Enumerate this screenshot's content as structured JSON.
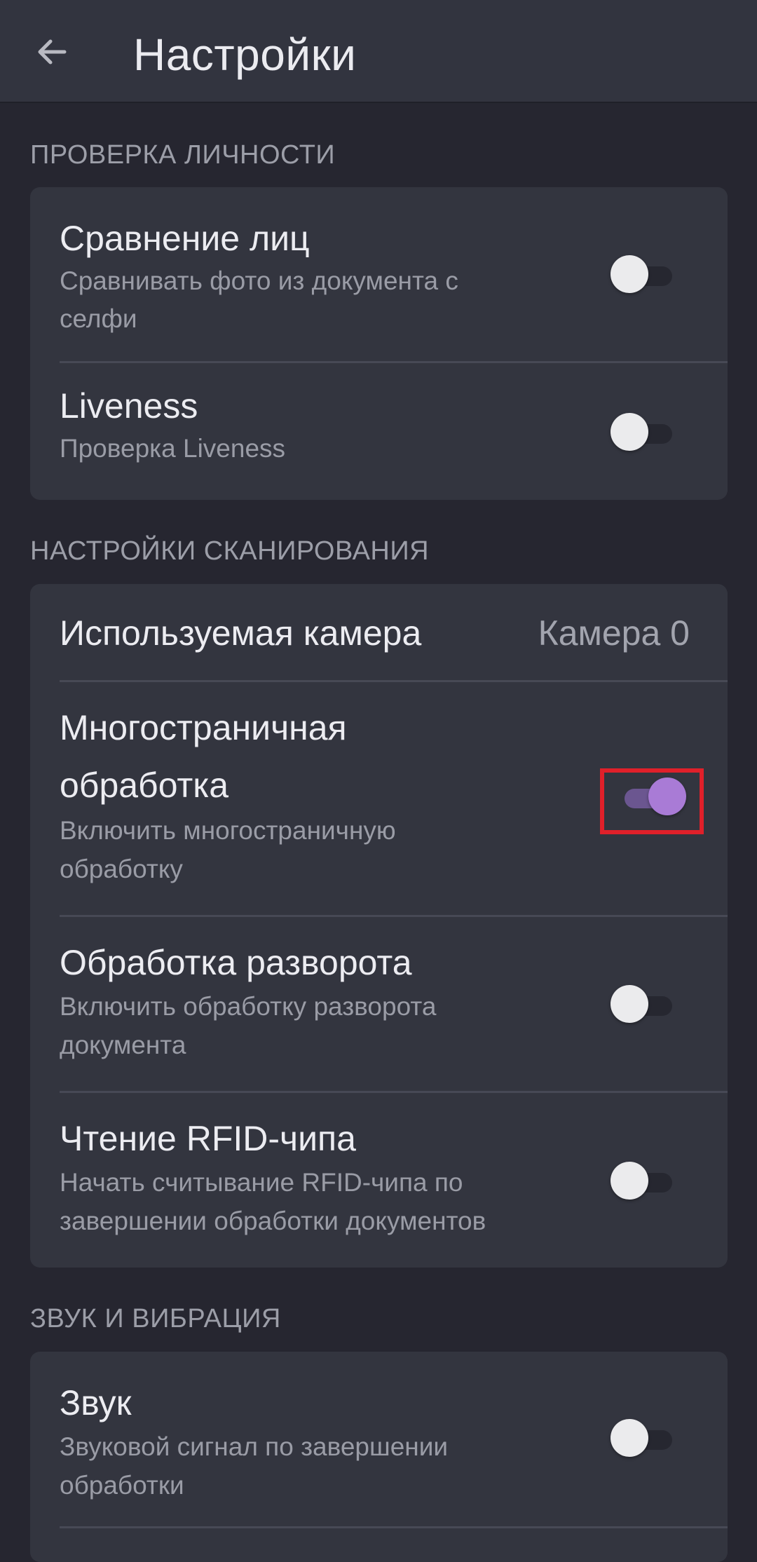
{
  "header": {
    "back_icon": "arrow-back-icon",
    "title": "Настройки"
  },
  "sections": [
    {
      "header": "ПРОВЕРКА ЛИЧНОСТИ",
      "items": [
        {
          "title": "Сравнение лиц",
          "subtitle_line1": "Сравнивать фото из документа с",
          "subtitle_line2": "селфи",
          "enabled": false
        },
        {
          "title": "Liveness",
          "subtitle_line1": "Проверка Liveness",
          "enabled": false
        }
      ]
    },
    {
      "header": "НАСТРОЙКИ СКАНИРОВАНИЯ",
      "items": [
        {
          "title": "Используемая камера",
          "value": "Камера 0"
        },
        {
          "title_line1": "Многостраничная",
          "title_line2": "обработка",
          "subtitle_line1": "Включить многостраничную",
          "subtitle_line2": "обработку",
          "enabled": true
        },
        {
          "title": "Обработка разворота",
          "subtitle_line1": "Включить обработку разворота",
          "subtitle_line2": "документа",
          "enabled": false
        },
        {
          "title": "Чтение RFID-чипа",
          "subtitle_line1": "Начать считывание RFID-чипа по",
          "subtitle_line2": "завершении обработки документов",
          "enabled": false
        }
      ]
    },
    {
      "header": "ЗВУК И ВИБРАЦИЯ",
      "items": [
        {
          "title": "Звук",
          "subtitle_line1": "Звуковой сигнал по завершении",
          "subtitle_line2": "обработки",
          "enabled": false
        }
      ]
    }
  ],
  "colors": {
    "background": "#262630",
    "card": "#33353f",
    "accent_thumb": "#a97bd6",
    "accent_track": "#6b5690",
    "highlight": "#e0202a"
  }
}
